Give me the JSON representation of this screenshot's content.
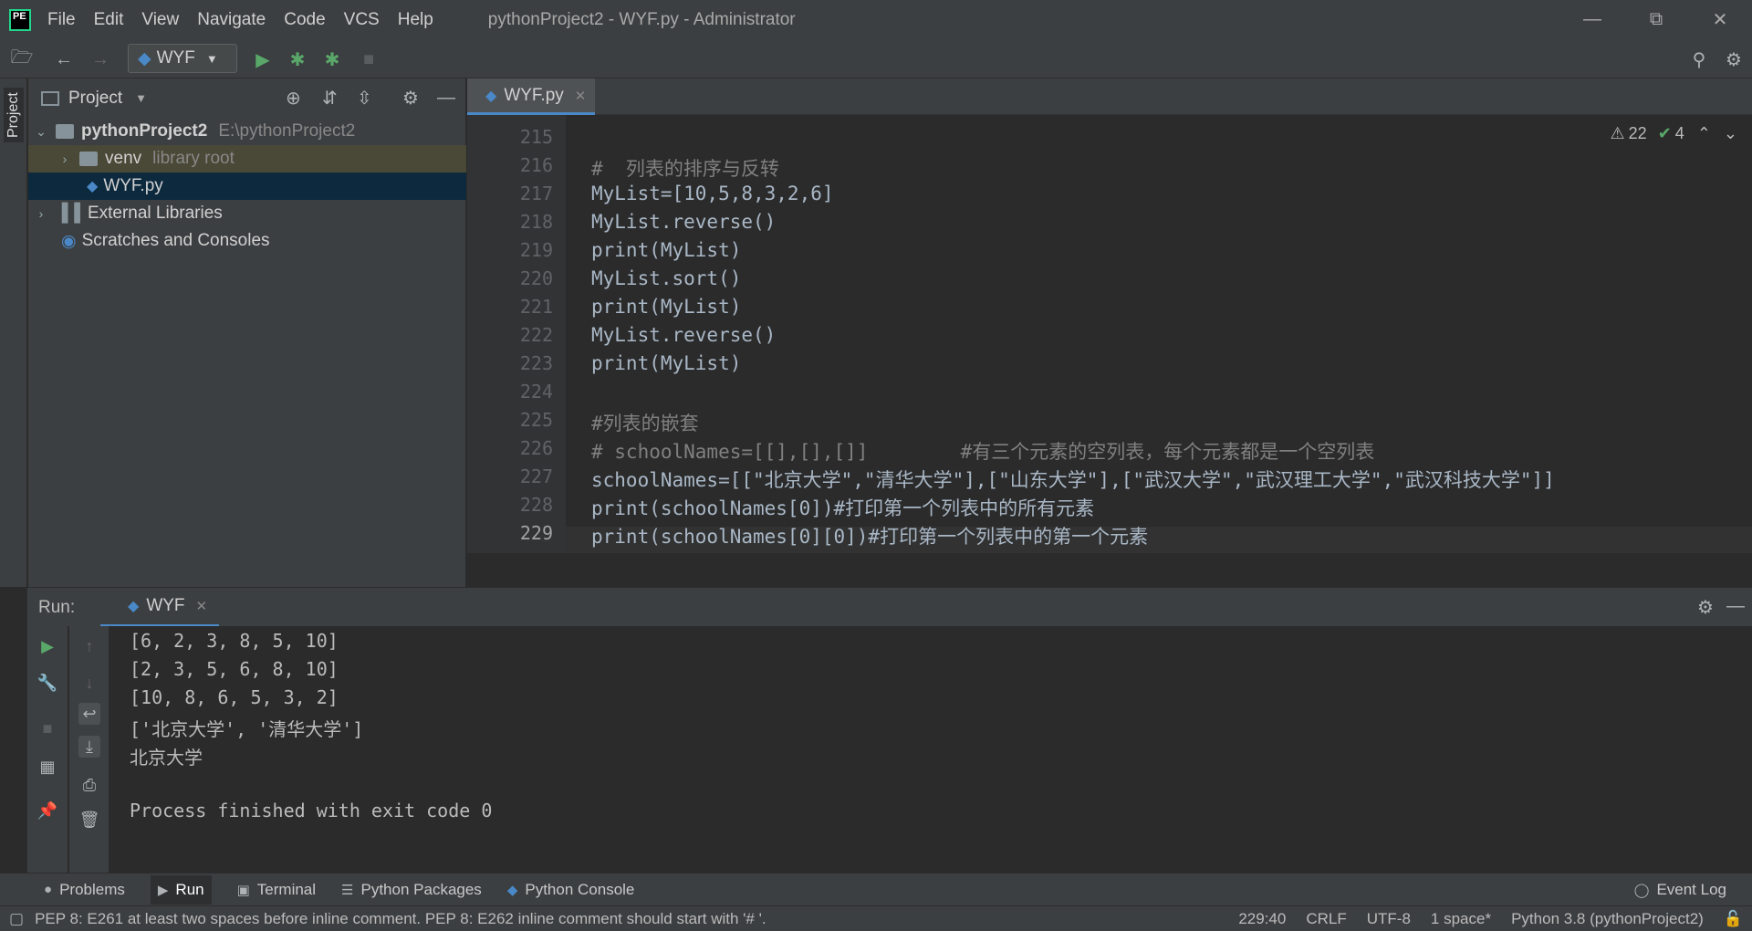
{
  "app": {
    "logo_text": "PE",
    "menu": [
      "File",
      "Edit",
      "View",
      "Navigate",
      "Code",
      "VCS",
      "Help"
    ],
    "window_title": "pythonProject2 - WYF.py - Administrator"
  },
  "toolbar": {
    "run_config": "WYF"
  },
  "project_panel": {
    "side_tab": "Project",
    "title": "Project",
    "tree": [
      {
        "name": "pythonProject2",
        "hint": "E:\\pythonProject2"
      },
      {
        "name": "venv",
        "hint": "library root"
      },
      {
        "name": "WYF.py",
        "hint": ""
      },
      {
        "name": "External Libraries",
        "hint": ""
      },
      {
        "name": "Scratches and Consoles",
        "hint": ""
      }
    ]
  },
  "editor": {
    "tab": "WYF.py",
    "warnings": "22",
    "checks": "4",
    "line_numbers": [
      "215",
      "216",
      "217",
      "218",
      "219",
      "220",
      "221",
      "222",
      "223",
      "224",
      "225",
      "226",
      "227",
      "228",
      "229"
    ],
    "lines": [
      "",
      "#  列表的排序与反转",
      "MyList=[10,5,8,3,2,6]",
      "MyList.reverse()",
      "print(MyList)",
      "MyList.sort()",
      "print(MyList)",
      "MyList.reverse()",
      "print(MyList)",
      "",
      "#列表的嵌套",
      "# schoolNames=[[],[],[]]        #有三个元素的空列表，每个元素都是一个空列表",
      "schoolNames=[[\"北京大学\",\"清华大学\"],[\"山东大学\"],[\"武汉大学\",\"武汉理工大学\",\"武汉科技大学\"]]",
      "print(schoolNames[0])#打印第一个列表中的所有元素",
      "print(schoolNames[0][0])#打印第一个列表中的第一个元素"
    ]
  },
  "run_panel": {
    "label": "Run:",
    "tab": "WYF",
    "output": [
      "[6, 2, 3, 8, 5, 10]",
      "[2, 3, 5, 6, 8, 10]",
      "[10, 8, 6, 5, 3, 2]",
      "['北京大学', '清华大学']",
      "北京大学",
      "",
      "Process finished with exit code 0"
    ]
  },
  "bottom_tabs": [
    "Problems",
    "Run",
    "Terminal",
    "Python Packages",
    "Python Console"
  ],
  "event_log": "Event Log",
  "status": {
    "message": "PEP 8: E261 at least two spaces before inline comment. PEP 8: E262 inline comment should start with '# '.",
    "position": "229:40",
    "line_sep": "CRLF",
    "encoding": "UTF-8",
    "indent": "1 space*",
    "interpreter": "Python 3.8 (pythonProject2)"
  }
}
